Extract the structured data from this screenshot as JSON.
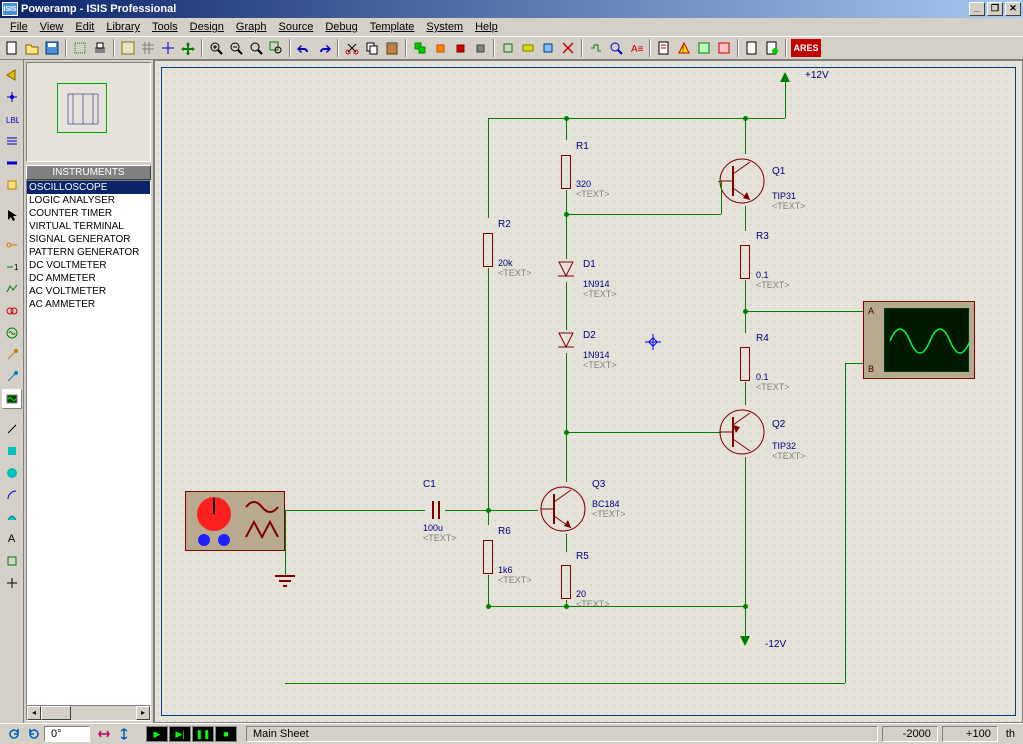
{
  "title": "Poweramp - ISIS Professional",
  "title_icon": "ISIS",
  "menus": [
    "File",
    "View",
    "Edit",
    "Library",
    "Tools",
    "Design",
    "Graph",
    "Source",
    "Debug",
    "Template",
    "System",
    "Help"
  ],
  "list_header": "INSTRUMENTS",
  "instruments": [
    "OSCILLOSCOPE",
    "LOGIC ANALYSER",
    "COUNTER TIMER",
    "VIRTUAL TERMINAL",
    "SIGNAL GENERATOR",
    "PATTERN GENERATOR",
    "DC VOLTMETER",
    "DC AMMETER",
    "AC VOLTMETER",
    "AC AMMETER"
  ],
  "selected_instrument": 0,
  "status": {
    "rotation": "0°",
    "sheet": "Main Sheet",
    "x": "-2000",
    "y": "+100",
    "unit": "th"
  },
  "rails": {
    "pos": "+12V",
    "neg": "-12V"
  },
  "components": {
    "c1": {
      "ref": "C1",
      "val": "100u",
      "txt": "<TEXT>"
    },
    "r1": {
      "ref": "R1",
      "val": "320",
      "txt": "<TEXT>"
    },
    "r2": {
      "ref": "R2",
      "val": "20k",
      "txt": "<TEXT>"
    },
    "r3": {
      "ref": "R3",
      "val": "0.1",
      "txt": "<TEXT>"
    },
    "r4": {
      "ref": "R4",
      "val": "0.1",
      "txt": "<TEXT>"
    },
    "r5": {
      "ref": "R5",
      "val": "20",
      "txt": "<TEXT>"
    },
    "r6": {
      "ref": "R6",
      "val": "1k6",
      "txt": "<TEXT>"
    },
    "d1": {
      "ref": "D1",
      "val": "1N914",
      "txt": "<TEXT>"
    },
    "d2": {
      "ref": "D2",
      "val": "1N914",
      "txt": "<TEXT>"
    },
    "q1": {
      "ref": "Q1",
      "val": "TIP31",
      "txt": "<TEXT>"
    },
    "q2": {
      "ref": "Q2",
      "val": "TIP32",
      "txt": "<TEXT>"
    },
    "q3": {
      "ref": "Q3",
      "val": "BC184",
      "txt": "<TEXT>"
    }
  },
  "scope": {
    "a": "A",
    "b": "B"
  },
  "ares_btn": "ARES"
}
